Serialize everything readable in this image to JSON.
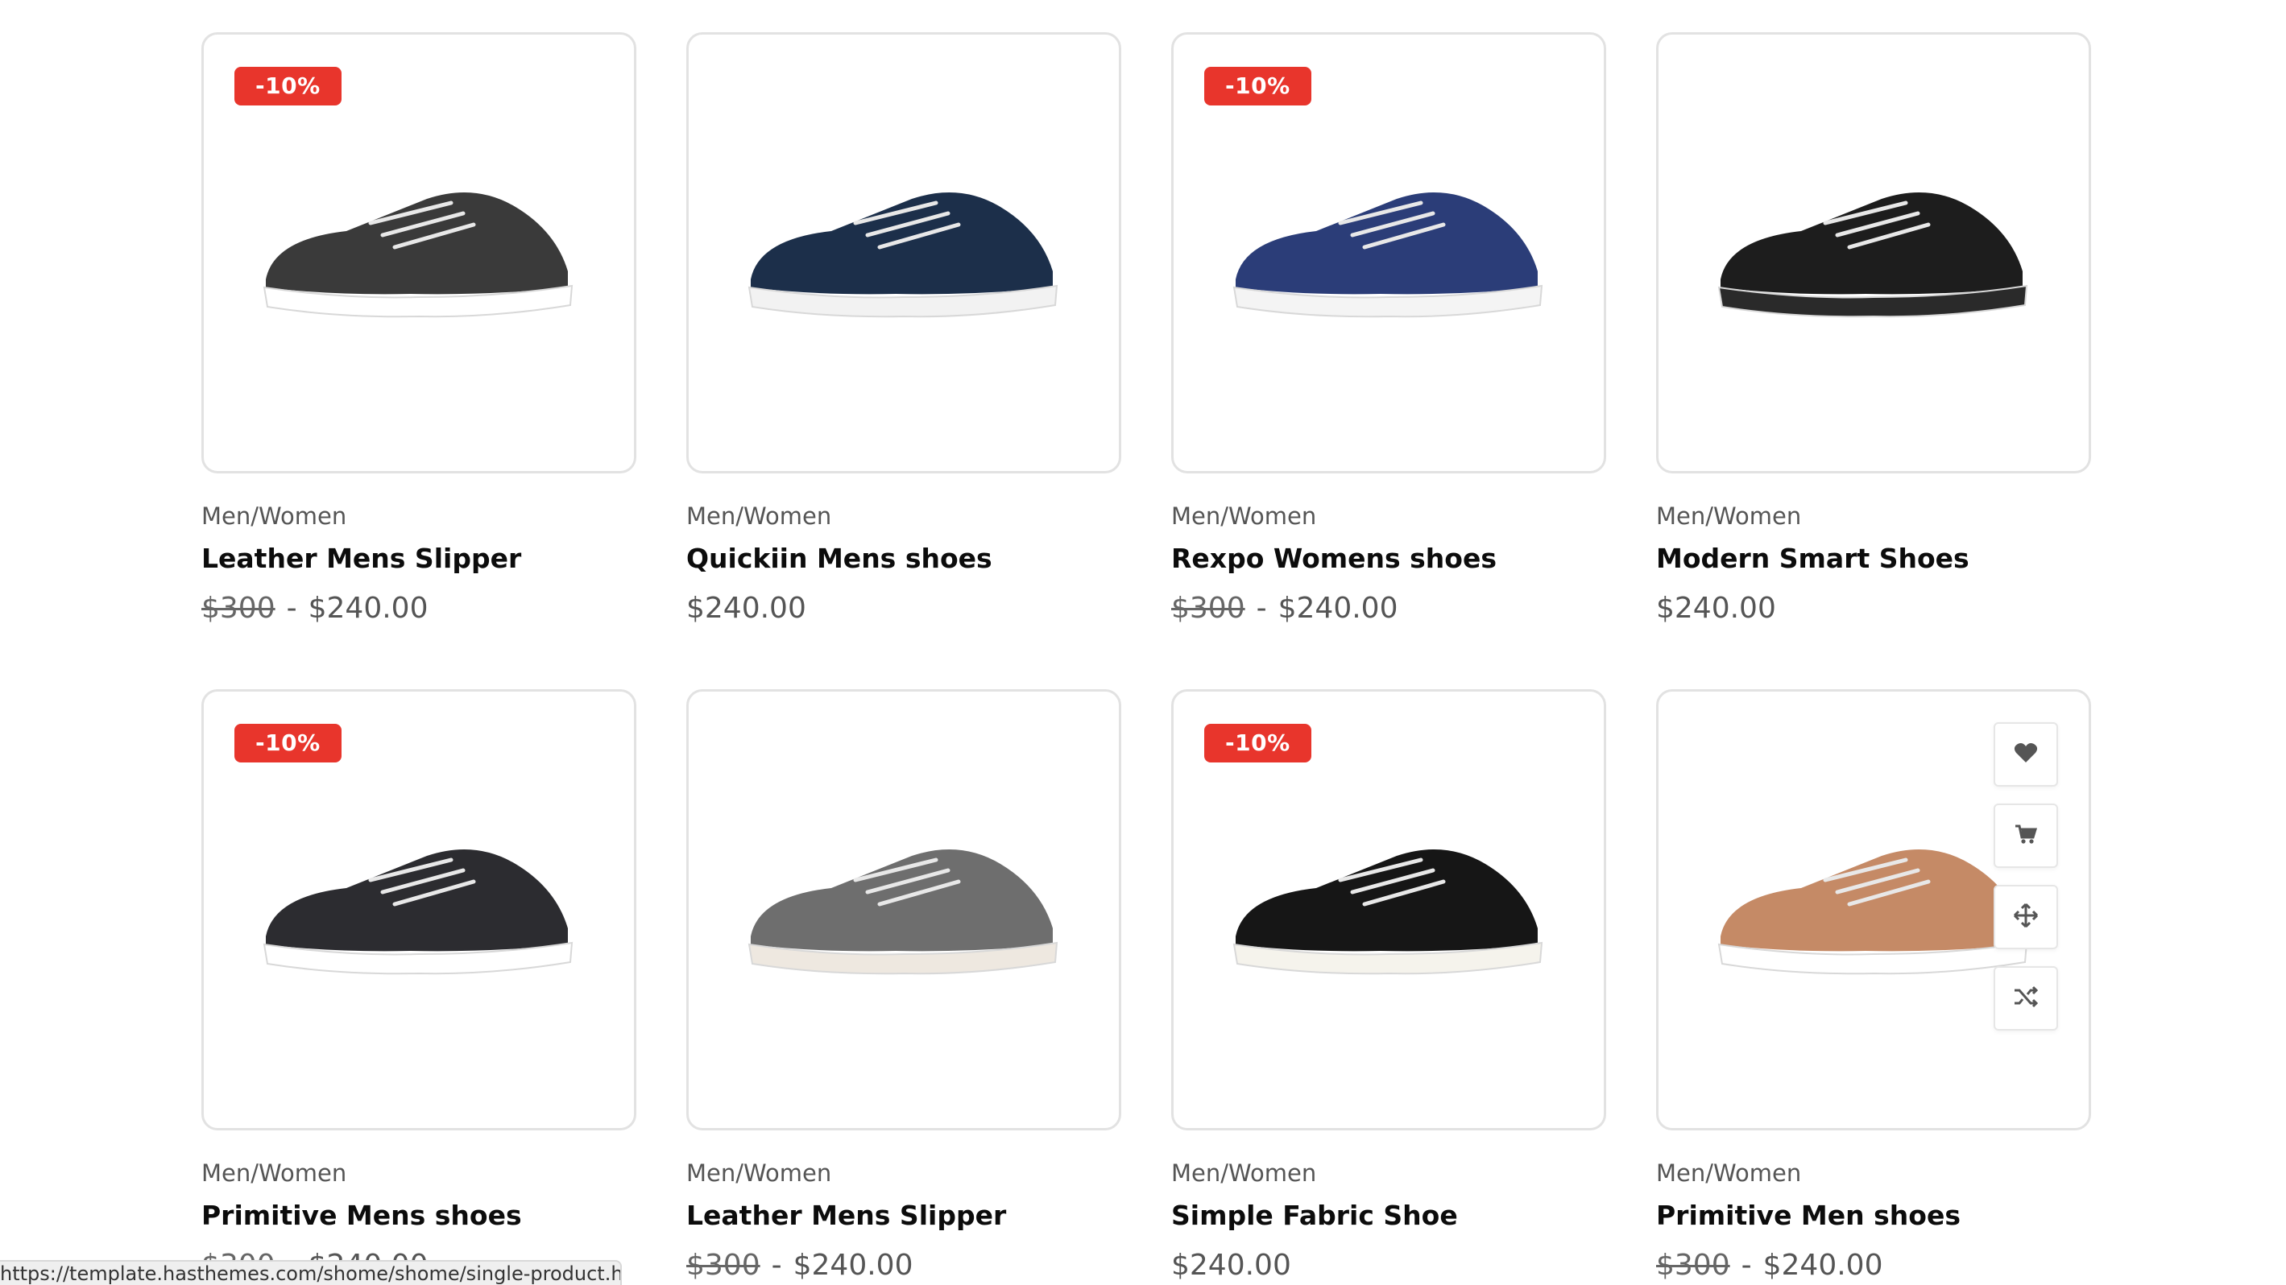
{
  "products": [
    {
      "category": "Men/Women",
      "title": "Leather Mens Slipper",
      "badge": "-10%",
      "old_price": "$300",
      "separator": "-",
      "price": "$240.00",
      "shoe_color": "#3a3a3a",
      "sole_color": "#ffffff"
    },
    {
      "category": "Men/Women",
      "title": "Quickiin Mens shoes",
      "badge": "",
      "old_price": "",
      "separator": "",
      "price": "$240.00",
      "shoe_color": "#1c2f4a",
      "sole_color": "#f2f2f2"
    },
    {
      "category": "Men/Women",
      "title": "Rexpo Womens shoes",
      "badge": "-10%",
      "old_price": "$300",
      "separator": "-",
      "price": "$240.00",
      "shoe_color": "#2b3d78",
      "sole_color": "#f4f4f4"
    },
    {
      "category": "Men/Women",
      "title": "Modern Smart Shoes",
      "badge": "",
      "old_price": "",
      "separator": "",
      "price": "$240.00",
      "shoe_color": "#1d1d1d",
      "sole_color": "#2a2a2a"
    },
    {
      "category": "Men/Women",
      "title": "Primitive Mens shoes",
      "badge": "-10%",
      "old_price": "$300",
      "separator": "-",
      "price": "$240.00",
      "shoe_color": "#2c2c30",
      "sole_color": "#ffffff"
    },
    {
      "category": "Men/Women",
      "title": "Leather Mens Slipper",
      "badge": "",
      "old_price": "$300",
      "separator": "-",
      "price": "$240.00",
      "shoe_color": "#6e6e6e",
      "sole_color": "#eee8e0"
    },
    {
      "category": "Men/Women",
      "title": "Simple Fabric Shoe",
      "badge": "-10%",
      "old_price": "",
      "separator": "",
      "price": "$240.00",
      "shoe_color": "#161616",
      "sole_color": "#f5f3ec"
    },
    {
      "category": "Men/Women",
      "title": "Primitive Men shoes",
      "badge": "",
      "old_price": "$300",
      "separator": "-",
      "price": "$240.00",
      "shoe_color": "#c58a66",
      "sole_color": "#ffffff"
    }
  ],
  "hover_actions": [
    "wishlist",
    "add-to-cart",
    "quick-view",
    "compare"
  ],
  "status_url": "https://template.hasthemes.com/shome/shome/single-product.html",
  "colors": {
    "badge": "#e8352c",
    "border": "#e2e2e2"
  }
}
